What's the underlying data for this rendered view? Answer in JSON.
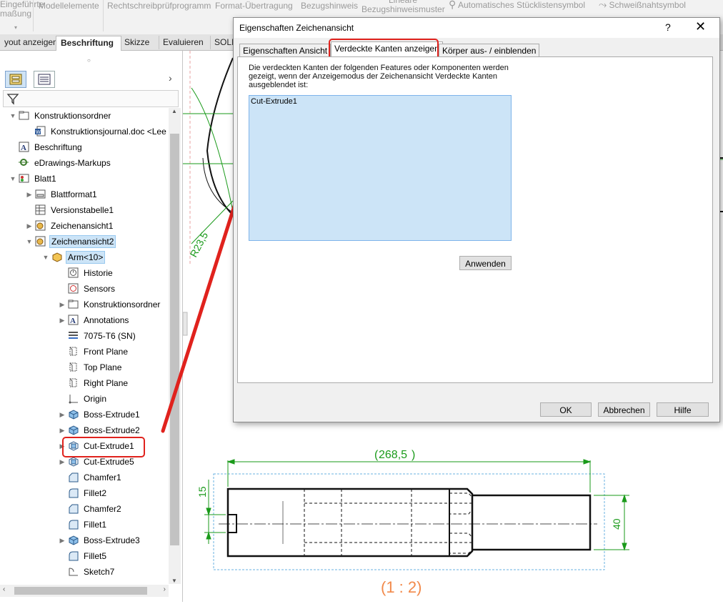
{
  "ribbon": {
    "items": [
      {
        "label": "Lineare\nBezugshinweismuster"
      },
      {
        "label": "Modellelemente"
      },
      {
        "label": "Rechtschreibprüfprogramm"
      },
      {
        "label": "Format-Übertragung"
      },
      {
        "label": "Bezugshinweis"
      },
      {
        "label": "Automatisches Stücklistensymbol"
      },
      {
        "label": "Schweißnahtsymbol"
      }
    ],
    "left_fragment_1": "Eingeführte",
    "left_fragment_2": "maßung"
  },
  "cm_tabs": [
    "yout anzeigen",
    "Beschriftung",
    "Skizze",
    "Evaluieren",
    "SOLI"
  ],
  "active_cm_tab": "Beschriftung",
  "tree": [
    {
      "label": "Konstruktionsordner",
      "indent": 0,
      "exp": "open",
      "icon": "folder-icon"
    },
    {
      "label": "Konstruktionsjournal.doc <Lee",
      "indent": 1,
      "exp": "",
      "icon": "word-document-icon"
    },
    {
      "label": "Beschriftung",
      "indent": 0,
      "exp": "",
      "icon": "annotation-icon"
    },
    {
      "label": "eDrawings-Markups",
      "indent": 0,
      "exp": "",
      "icon": "markup-icon"
    },
    {
      "label": "Blatt1",
      "indent": 0,
      "exp": "open",
      "icon": "sheet-icon"
    },
    {
      "label": "Blattformat1",
      "indent": 1,
      "exp": "closed",
      "icon": "sheet-format-icon"
    },
    {
      "label": "Versionstabelle1",
      "indent": 1,
      "exp": "",
      "icon": "table-icon"
    },
    {
      "label": "Zeichenansicht1",
      "indent": 1,
      "exp": "closed",
      "icon": "drawing-view-icon"
    },
    {
      "label": "Zeichenansicht2",
      "indent": 1,
      "exp": "open",
      "icon": "drawing-view-icon",
      "highlight": true
    },
    {
      "label": "Arm<10>",
      "indent": 2,
      "exp": "open",
      "icon": "part-icon",
      "highlight": true
    },
    {
      "label": "Historie",
      "indent": 3,
      "exp": "",
      "icon": "history-icon"
    },
    {
      "label": "Sensors",
      "indent": 3,
      "exp": "",
      "icon": "sensor-icon"
    },
    {
      "label": "Konstruktionsordner",
      "indent": 3,
      "exp": "closed",
      "icon": "folder-icon"
    },
    {
      "label": "Annotations",
      "indent": 3,
      "exp": "closed",
      "icon": "annotation-icon"
    },
    {
      "label": "7075-T6 (SN)",
      "indent": 3,
      "exp": "",
      "icon": "material-icon"
    },
    {
      "label": "Front Plane",
      "indent": 3,
      "exp": "",
      "icon": "plane-icon"
    },
    {
      "label": "Top Plane",
      "indent": 3,
      "exp": "",
      "icon": "plane-icon"
    },
    {
      "label": "Right Plane",
      "indent": 3,
      "exp": "",
      "icon": "plane-icon"
    },
    {
      "label": "Origin",
      "indent": 3,
      "exp": "",
      "icon": "origin-icon"
    },
    {
      "label": "Boss-Extrude1",
      "indent": 3,
      "exp": "closed",
      "icon": "boss-extrude-icon"
    },
    {
      "label": "Boss-Extrude2",
      "indent": 3,
      "exp": "closed",
      "icon": "boss-extrude-icon"
    },
    {
      "label": "Cut-Extrude1",
      "indent": 3,
      "exp": "closed",
      "icon": "cut-extrude-icon"
    },
    {
      "label": "Cut-Extrude5",
      "indent": 3,
      "exp": "closed",
      "icon": "cut-extrude-icon"
    },
    {
      "label": "Chamfer1",
      "indent": 3,
      "exp": "",
      "icon": "chamfer-icon"
    },
    {
      "label": "Fillet2",
      "indent": 3,
      "exp": "",
      "icon": "fillet-icon"
    },
    {
      "label": "Chamfer2",
      "indent": 3,
      "exp": "",
      "icon": "chamfer-icon"
    },
    {
      "label": "Fillet1",
      "indent": 3,
      "exp": "",
      "icon": "fillet-icon"
    },
    {
      "label": "Boss-Extrude3",
      "indent": 3,
      "exp": "closed",
      "icon": "boss-extrude-icon"
    },
    {
      "label": "Fillet5",
      "indent": 3,
      "exp": "",
      "icon": "fillet-icon"
    },
    {
      "label": "Sketch7",
      "indent": 3,
      "exp": "",
      "icon": "sketch-icon"
    }
  ],
  "drawing": {
    "dim_length": "268,5",
    "dim_left": "15",
    "dim_right": "40",
    "dim_radius": "R23,5",
    "scale_label": "(1 : 2)"
  },
  "dialog": {
    "title": "Eigenschaften Zeichenansicht",
    "help": "?",
    "close": "✕",
    "tabs": [
      "Eigenschaften Ansicht",
      "Verdeckte Kanten anzeigen",
      "Körper aus- / einblenden"
    ],
    "active_tab": "Verdeckte Kanten anzeigen",
    "description": "Die verdeckten Kanten der folgenden Features oder Komponenten werden gezeigt, wenn der Anzeigemodus der Zeichenansicht Verdeckte Kanten ausgeblendet ist:",
    "list_items": [
      "Cut-Extrude1"
    ],
    "apply_button": "Anwenden",
    "ok_button": "OK",
    "cancel_button": "Abbrechen",
    "help_button": "Hilfe"
  },
  "colors": {
    "highlight_red": "#e0221d",
    "dimension_green": "#1a9a1a",
    "scale_orange": "#f28a4b",
    "selection_blue": "#cce4f7"
  }
}
